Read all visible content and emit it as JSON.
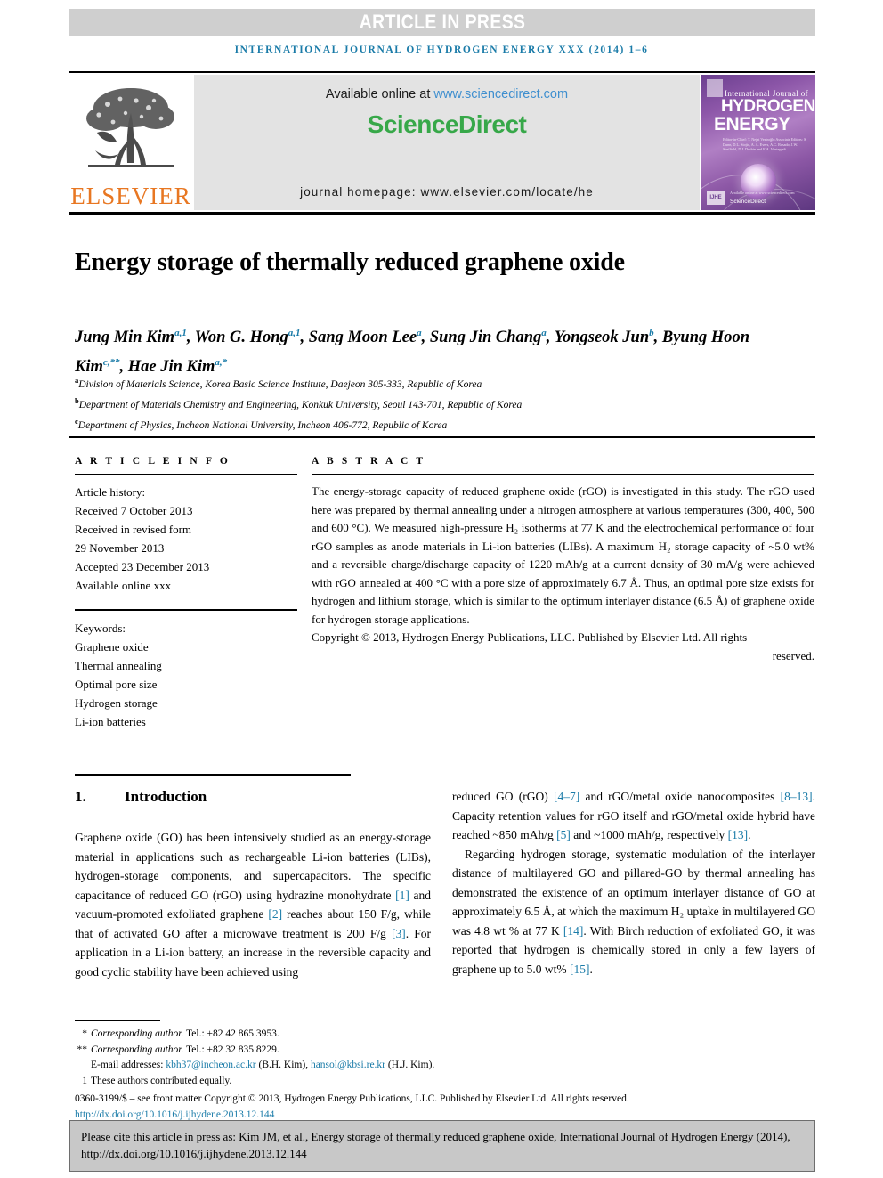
{
  "banner": {
    "text": "ARTICLE IN PRESS"
  },
  "running_head": {
    "text": "INTERNATIONAL JOURNAL OF HYDROGEN ENERGY XXX (2014) 1–6"
  },
  "masthead": {
    "elsevier_wordmark": "ELSEVIER",
    "available_prefix": "Available online at ",
    "available_url": "www.sciencedirect.com",
    "sciencedirect_brand": "ScienceDirect",
    "journal_homepage": "journal homepage: www.elsevier.com/locate/he",
    "cover": {
      "line_small": "International Journal of",
      "line_hydrogen": "HYDROGEN",
      "line_energy": "ENERGY",
      "editors": "Editor-in-Chief: T. Nejat Veziroğlu    Associate Editors: S. Dunn, D.L. Stojic, A. A. Evers, A.C. Rosado, J.W. Sheffield, D.J. Durbin and E.A. Ventegodt",
      "els_badge": "IJHE",
      "sciencedirect_small": "ScienceDirect",
      "available_small": "Available online at www.sciencedirect.com"
    }
  },
  "article": {
    "title": "Energy storage of thermally reduced graphene oxide",
    "authors": [
      {
        "name": "Jung Min Kim",
        "sup": "a,1",
        "sep": ", "
      },
      {
        "name": "Won G. Hong",
        "sup": "a,1",
        "sep": ", "
      },
      {
        "name": "Sang Moon Lee",
        "sup": "a",
        "sep": ", "
      },
      {
        "name": "Sung Jin Chang",
        "sup": "a",
        "sep": ", "
      },
      {
        "name": "Yongseok Jun",
        "sup": "b",
        "sep": ", "
      },
      {
        "name": "Byung Hoon Kim",
        "sup": "c,**",
        "sep": ", "
      },
      {
        "name": "Hae Jin Kim",
        "sup": "a,*",
        "sep": ""
      }
    ],
    "affiliations": [
      {
        "mark": "a",
        "text": "Division of Materials Science, Korea Basic Science Institute, Daejeon 305-333, Republic of Korea"
      },
      {
        "mark": "b",
        "text": "Department of Materials Chemistry and Engineering, Konkuk University, Seoul 143-701, Republic of Korea"
      },
      {
        "mark": "c",
        "text": "Department of Physics, Incheon National University, Incheon 406-772, Republic of Korea"
      }
    ]
  },
  "article_info": {
    "heading": "A R T I C L E   I N F O",
    "history_label": "Article history:",
    "history": [
      "Received 7 October 2013",
      "Received in revised form",
      "29 November 2013",
      "Accepted 23 December 2013",
      "Available online xxx"
    ],
    "keywords_label": "Keywords:",
    "keywords": [
      "Graphene oxide",
      "Thermal annealing",
      "Optimal pore size",
      "Hydrogen storage",
      "Li-ion batteries"
    ]
  },
  "abstract": {
    "heading": "A B S T R A C T",
    "body": "The energy-storage capacity of reduced graphene oxide (rGO) is investigated in this study. The rGO used here was prepared by thermal annealing under a nitrogen atmosphere at various temperatures (300, 400, 500 and 600 °C). We measured high-pressure H₂ isotherms at 77 K and the electrochemical performance of four rGO samples as anode materials in Li-ion batteries (LIBs). A maximum H₂ storage capacity of ~5.0 wt% and a reversible charge/discharge capacity of 1220 mAh/g at a current density of 30 mA/g were achieved with rGO annealed at 400 °C with a pore size of approximately 6.7 Å. Thus, an optimal pore size exists for hydrogen and lithium storage, which is similar to the optimum interlayer distance (6.5 Å) of graphene oxide for hydrogen storage applications.",
    "copyright_main": "Copyright © 2013, Hydrogen Energy Publications, LLC. Published by Elsevier Ltd. All rights",
    "copyright_tail": "reserved."
  },
  "section": {
    "number": "1.",
    "title": "Introduction"
  },
  "body_left": {
    "p1_a": "Graphene oxide (GO) has been intensively studied as an energy-storage material in applications such as rechargeable Li-ion batteries (LIBs), hydrogen-storage components, and supercapacitors. The specific capacitance of reduced GO (rGO) using hydrazine monohydrate ",
    "r1": "[1]",
    "p1_b": " and vacuum-promoted exfoliated graphene ",
    "r2": "[2]",
    "p1_c": " reaches about 150 F/g, while that of activated GO after a microwave treatment is 200 F/g ",
    "r3": "[3]",
    "p1_d": ". For application in a Li-ion battery, an increase in the reversible capacity and good cyclic stability have been achieved using"
  },
  "body_right": {
    "p1_a": "reduced GO (rGO) ",
    "r47": "[4–7]",
    "p1_b": " and rGO/metal oxide nanocomposites ",
    "r813": "[8–13]",
    "p1_c": ". Capacity retention values for rGO itself and rGO/metal oxide hybrid have reached ~850 mAh/g ",
    "r5": "[5]",
    "p1_d": " and ~1000 mAh/g, respectively ",
    "r13": "[13]",
    "p1_e": ".",
    "p2_a": "Regarding hydrogen storage, systematic modulation of the interlayer distance of multilayered GO and pillared-GO by thermal annealing has demonstrated the existence of an optimum interlayer distance of GO at approximately 6.5 Å, at which the maximum H₂ uptake in multilayered GO was 4.8 wt % at 77 K ",
    "r14": "[14]",
    "p2_b": ". With Birch reduction of exfoliated GO, it was reported that hydrogen is chemically stored in only a few layers of graphene up to 5.0 wt% ",
    "r15": "[15]",
    "p2_c": "."
  },
  "footnotes": {
    "corr1_mark": "*",
    "corr1_ital": "Corresponding author.",
    "corr1_rest": " Tel.: +82 42 865 3953.",
    "corr2_mark": "**",
    "corr2_ital": "Corresponding author.",
    "corr2_rest": " Tel.: +82 32 835 8229.",
    "email_label": "E-mail addresses:",
    "email1": "kbh37@incheon.ac.kr",
    "email1_who": " (B.H. Kim), ",
    "email2": "hansol@kbsi.re.kr",
    "email2_who": " (H.J. Kim).",
    "equal_mark": "1",
    "equal_text": "These authors contributed equally.",
    "issn_line": "0360-3199/$ – see front matter Copyright © 2013, Hydrogen Energy Publications, LLC. Published by Elsevier Ltd. All rights reserved.",
    "doi": "http://dx.doi.org/10.1016/j.ijhydene.2013.12.144"
  },
  "cite_box": {
    "text": "Please cite this article in press as: Kim JM, et al., Energy storage of thermally reduced graphene oxide, International Journal of Hydrogen Energy (2014), http://dx.doi.org/10.1016/j.ijhydene.2013.12.144"
  },
  "colors": {
    "link": "#1a7ba8",
    "elsevier_orange": "#E87722",
    "sciencedirect_green": "#37A849",
    "banner_gray": "#cfcfcf",
    "panel_gray": "#e3e3e3",
    "cite_gray": "#c8c8c8"
  }
}
